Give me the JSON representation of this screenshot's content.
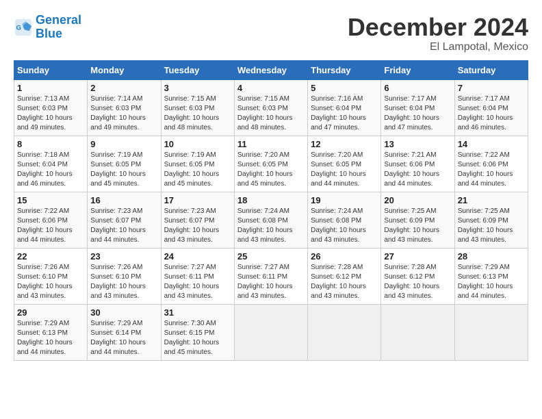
{
  "logo": {
    "line1": "General",
    "line2": "Blue"
  },
  "title": "December 2024",
  "subtitle": "El Lampotal, Mexico",
  "days_header": [
    "Sunday",
    "Monday",
    "Tuesday",
    "Wednesday",
    "Thursday",
    "Friday",
    "Saturday"
  ],
  "weeks": [
    [
      {
        "day": "1",
        "sunrise": "7:13 AM",
        "sunset": "6:03 PM",
        "daylight": "10 hours and 49 minutes."
      },
      {
        "day": "2",
        "sunrise": "7:14 AM",
        "sunset": "6:03 PM",
        "daylight": "10 hours and 49 minutes."
      },
      {
        "day": "3",
        "sunrise": "7:15 AM",
        "sunset": "6:03 PM",
        "daylight": "10 hours and 48 minutes."
      },
      {
        "day": "4",
        "sunrise": "7:15 AM",
        "sunset": "6:03 PM",
        "daylight": "10 hours and 48 minutes."
      },
      {
        "day": "5",
        "sunrise": "7:16 AM",
        "sunset": "6:04 PM",
        "daylight": "10 hours and 47 minutes."
      },
      {
        "day": "6",
        "sunrise": "7:17 AM",
        "sunset": "6:04 PM",
        "daylight": "10 hours and 47 minutes."
      },
      {
        "day": "7",
        "sunrise": "7:17 AM",
        "sunset": "6:04 PM",
        "daylight": "10 hours and 46 minutes."
      }
    ],
    [
      {
        "day": "8",
        "sunrise": "7:18 AM",
        "sunset": "6:04 PM",
        "daylight": "10 hours and 46 minutes."
      },
      {
        "day": "9",
        "sunrise": "7:19 AM",
        "sunset": "6:05 PM",
        "daylight": "10 hours and 45 minutes."
      },
      {
        "day": "10",
        "sunrise": "7:19 AM",
        "sunset": "6:05 PM",
        "daylight": "10 hours and 45 minutes."
      },
      {
        "day": "11",
        "sunrise": "7:20 AM",
        "sunset": "6:05 PM",
        "daylight": "10 hours and 45 minutes."
      },
      {
        "day": "12",
        "sunrise": "7:20 AM",
        "sunset": "6:05 PM",
        "daylight": "10 hours and 44 minutes."
      },
      {
        "day": "13",
        "sunrise": "7:21 AM",
        "sunset": "6:06 PM",
        "daylight": "10 hours and 44 minutes."
      },
      {
        "day": "14",
        "sunrise": "7:22 AM",
        "sunset": "6:06 PM",
        "daylight": "10 hours and 44 minutes."
      }
    ],
    [
      {
        "day": "15",
        "sunrise": "7:22 AM",
        "sunset": "6:06 PM",
        "daylight": "10 hours and 44 minutes."
      },
      {
        "day": "16",
        "sunrise": "7:23 AM",
        "sunset": "6:07 PM",
        "daylight": "10 hours and 44 minutes."
      },
      {
        "day": "17",
        "sunrise": "7:23 AM",
        "sunset": "6:07 PM",
        "daylight": "10 hours and 43 minutes."
      },
      {
        "day": "18",
        "sunrise": "7:24 AM",
        "sunset": "6:08 PM",
        "daylight": "10 hours and 43 minutes."
      },
      {
        "day": "19",
        "sunrise": "7:24 AM",
        "sunset": "6:08 PM",
        "daylight": "10 hours and 43 minutes."
      },
      {
        "day": "20",
        "sunrise": "7:25 AM",
        "sunset": "6:09 PM",
        "daylight": "10 hours and 43 minutes."
      },
      {
        "day": "21",
        "sunrise": "7:25 AM",
        "sunset": "6:09 PM",
        "daylight": "10 hours and 43 minutes."
      }
    ],
    [
      {
        "day": "22",
        "sunrise": "7:26 AM",
        "sunset": "6:10 PM",
        "daylight": "10 hours and 43 minutes."
      },
      {
        "day": "23",
        "sunrise": "7:26 AM",
        "sunset": "6:10 PM",
        "daylight": "10 hours and 43 minutes."
      },
      {
        "day": "24",
        "sunrise": "7:27 AM",
        "sunset": "6:11 PM",
        "daylight": "10 hours and 43 minutes."
      },
      {
        "day": "25",
        "sunrise": "7:27 AM",
        "sunset": "6:11 PM",
        "daylight": "10 hours and 43 minutes."
      },
      {
        "day": "26",
        "sunrise": "7:28 AM",
        "sunset": "6:12 PM",
        "daylight": "10 hours and 43 minutes."
      },
      {
        "day": "27",
        "sunrise": "7:28 AM",
        "sunset": "6:12 PM",
        "daylight": "10 hours and 43 minutes."
      },
      {
        "day": "28",
        "sunrise": "7:29 AM",
        "sunset": "6:13 PM",
        "daylight": "10 hours and 44 minutes."
      }
    ],
    [
      {
        "day": "29",
        "sunrise": "7:29 AM",
        "sunset": "6:13 PM",
        "daylight": "10 hours and 44 minutes."
      },
      {
        "day": "30",
        "sunrise": "7:29 AM",
        "sunset": "6:14 PM",
        "daylight": "10 hours and 44 minutes."
      },
      {
        "day": "31",
        "sunrise": "7:30 AM",
        "sunset": "6:15 PM",
        "daylight": "10 hours and 45 minutes."
      },
      null,
      null,
      null,
      null
    ]
  ]
}
